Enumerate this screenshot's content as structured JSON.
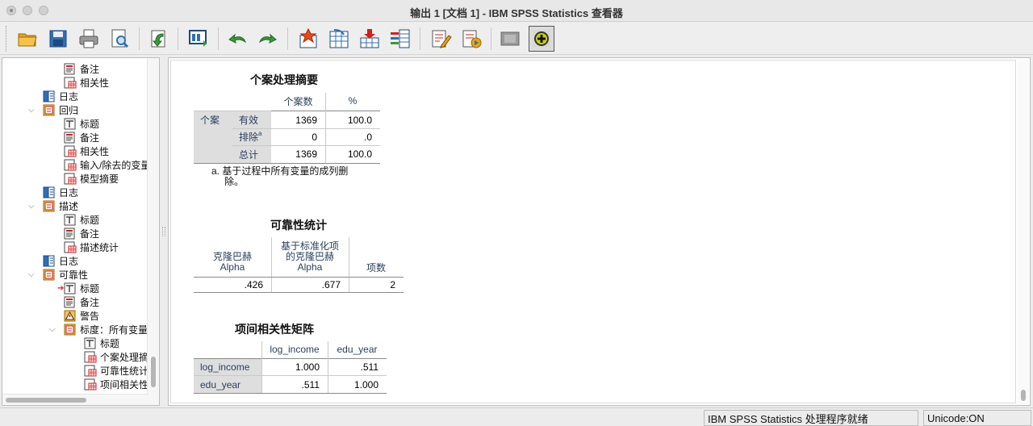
{
  "window": {
    "title": "输出 1 [文档 1] - IBM SPSS Statistics 查看器"
  },
  "toolbar": {
    "buttons": [
      {
        "name": "open-icon"
      },
      {
        "name": "save-icon"
      },
      {
        "name": "print-icon"
      },
      {
        "name": "print-preview-icon"
      },
      {
        "name": "export-icon"
      },
      {
        "name": "recall-dialog-icon"
      },
      {
        "name": "undo-icon"
      },
      {
        "name": "redo-icon"
      },
      {
        "name": "goto-data-icon"
      },
      {
        "name": "goto-case-icon"
      },
      {
        "name": "insert-output-icon"
      },
      {
        "name": "variables-icon"
      },
      {
        "name": "edit-icon"
      },
      {
        "name": "show-icon"
      },
      {
        "name": "hide-icon"
      },
      {
        "name": "designate-window-icon"
      }
    ]
  },
  "outline": {
    "items": [
      {
        "label": "备注",
        "icon": "notes-icon"
      },
      {
        "label": "相关性",
        "icon": "table-icon"
      },
      {
        "label": "日志",
        "icon": "log-icon"
      },
      {
        "label": "回归",
        "icon": "procedure-icon",
        "expanded": true
      },
      {
        "label": "标题",
        "icon": "title-icon"
      },
      {
        "label": "备注",
        "icon": "notes-icon"
      },
      {
        "label": "相关性",
        "icon": "table-icon"
      },
      {
        "label": "输入/除去的变量",
        "icon": "table-icon"
      },
      {
        "label": "模型摘要",
        "icon": "table-icon"
      },
      {
        "label": "日志",
        "icon": "log-icon"
      },
      {
        "label": "描述",
        "icon": "procedure-icon",
        "expanded": true
      },
      {
        "label": "标题",
        "icon": "title-icon"
      },
      {
        "label": "备注",
        "icon": "notes-icon"
      },
      {
        "label": "描述统计",
        "icon": "table-icon"
      },
      {
        "label": "日志",
        "icon": "log-icon"
      },
      {
        "label": "可靠性",
        "icon": "procedure-icon",
        "expanded": true
      },
      {
        "label": "标题",
        "icon": "title-icon",
        "current": true
      },
      {
        "label": "备注",
        "icon": "notes-icon"
      },
      {
        "label": "警告",
        "icon": "warning-icon"
      },
      {
        "label": "标度：所有变量",
        "icon": "procedure-icon",
        "expanded": true
      },
      {
        "label": "标题",
        "icon": "title-icon"
      },
      {
        "label": "个案处理摘要",
        "icon": "table-icon"
      },
      {
        "label": "可靠性统计",
        "icon": "table-icon"
      },
      {
        "label": "项间相关性矩阵",
        "icon": "table-icon"
      }
    ]
  },
  "case_summary": {
    "title": "个案处理摘要",
    "col_count": "个案数",
    "col_pct": "%",
    "group": "个案",
    "rows": [
      {
        "label": "有效",
        "count": "1369",
        "pct": "100.0"
      },
      {
        "label": "排除",
        "sup": "a",
        "count": "0",
        "pct": ".0"
      },
      {
        "label": "总计",
        "count": "1369",
        "pct": "100.0"
      }
    ],
    "footnote_line1": "a. 基于过程中所有变量的成列删",
    "footnote_line2": "除。"
  },
  "reliability": {
    "title": "可靠性统计",
    "h1_line1": "克隆巴赫",
    "h1_line2": "Alpha",
    "h2_line1": "基于标准化项",
    "h2_line2": "的克隆巴赫",
    "h2_line3": "Alpha",
    "h3": "项数",
    "v1": ".426",
    "v2": ".677",
    "v3": "2"
  },
  "inter_item": {
    "title": "项间相关性矩阵",
    "cols": [
      "log_income",
      "edu_year"
    ],
    "rows": [
      {
        "label": "log_income",
        "v1": "1.000",
        "v2": ".511"
      },
      {
        "label": "edu_year",
        "v1": ".511",
        "v2": "1.000"
      }
    ]
  },
  "status": {
    "processor": "IBM SPSS Statistics 处理程序就绪",
    "unicode": "Unicode:ON"
  },
  "colors": {
    "accent": "#2a3f5f",
    "shade": "#dedede"
  }
}
